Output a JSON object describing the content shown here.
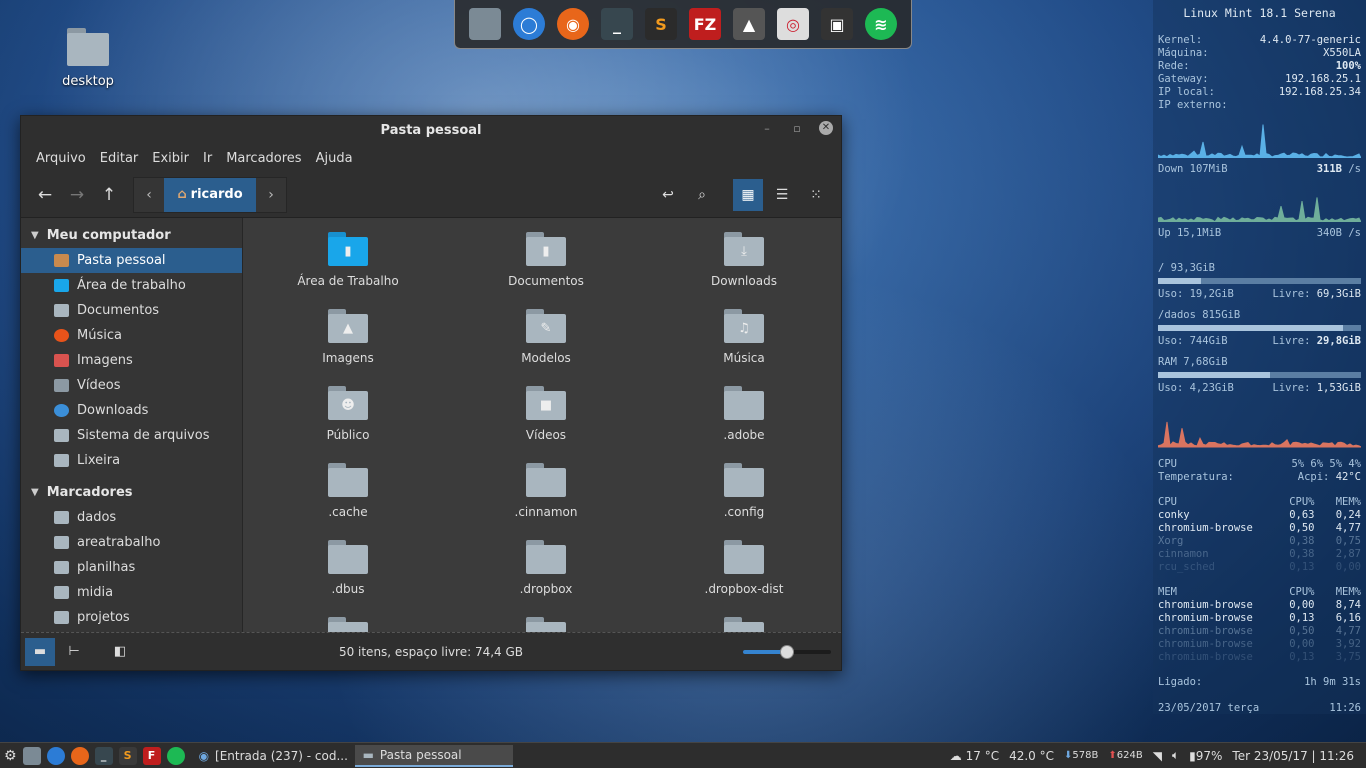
{
  "desktop": {
    "icon_label": "desktop"
  },
  "dock": {
    "apps": [
      {
        "name": "files",
        "glyph": "",
        "color": "#7b8a95"
      },
      {
        "name": "chromium",
        "glyph": "◯",
        "color": "#2c7cd6"
      },
      {
        "name": "firefox",
        "glyph": "◉",
        "color": "#e8661a"
      },
      {
        "name": "terminal",
        "glyph": "_",
        "color": "#37474f"
      },
      {
        "name": "sublime",
        "glyph": "S",
        "color": "#2b2b2b"
      },
      {
        "name": "filezilla",
        "glyph": "FZ",
        "color": "#bf1e1e"
      },
      {
        "name": "inkscape",
        "glyph": "▲",
        "color": "#555555"
      },
      {
        "name": "camera",
        "glyph": "◎",
        "color": "#dddddd"
      },
      {
        "name": "video-editor",
        "glyph": "▣",
        "color": "#333333"
      },
      {
        "name": "spotify",
        "glyph": "≋",
        "color": "#1db954"
      }
    ]
  },
  "window": {
    "title": "Pasta pessoal",
    "menu": [
      "Arquivo",
      "Editar",
      "Exibir",
      "Ir",
      "Marcadores",
      "Ajuda"
    ],
    "path": {
      "current": "ricardo"
    },
    "sidebar": {
      "section1": "Meu computador",
      "items1": [
        {
          "label": "Pasta pessoal",
          "icon": "home-icon",
          "color": "#c98a4e"
        },
        {
          "label": "Área de trabalho",
          "icon": "desktop-folder-icon",
          "color": "#19a6ea"
        },
        {
          "label": "Documentos",
          "icon": "documents-icon",
          "color": "#a9b6bf"
        },
        {
          "label": "Música",
          "icon": "music-icon",
          "color": "#e8531a"
        },
        {
          "label": "Imagens",
          "icon": "images-icon",
          "color": "#d9534f"
        },
        {
          "label": "Vídeos",
          "icon": "videos-icon",
          "color": "#8c99a3"
        },
        {
          "label": "Downloads",
          "icon": "downloads-icon",
          "color": "#3b8fd9"
        },
        {
          "label": "Sistema de arquivos",
          "icon": "filesystem-icon",
          "color": "#a9b6bf"
        },
        {
          "label": "Lixeira",
          "icon": "trash-icon",
          "color": "#a9b6bf"
        }
      ],
      "section2": "Marcadores",
      "items2": [
        {
          "label": "dados"
        },
        {
          "label": "areatrabalho"
        },
        {
          "label": "planilhas"
        },
        {
          "label": "midia"
        },
        {
          "label": "projetos"
        }
      ]
    },
    "files": [
      {
        "name": "Área de Trabalho",
        "glyph": "▮",
        "blue": true
      },
      {
        "name": "Documentos",
        "glyph": "▮"
      },
      {
        "name": "Downloads",
        "glyph": "⤓"
      },
      {
        "name": "Imagens",
        "glyph": "▲"
      },
      {
        "name": "Modelos",
        "glyph": "✎"
      },
      {
        "name": "Música",
        "glyph": "♫"
      },
      {
        "name": "Público",
        "glyph": "☻"
      },
      {
        "name": "Vídeos",
        "glyph": "■"
      },
      {
        "name": ".adobe",
        "glyph": ""
      },
      {
        "name": ".cache",
        "glyph": ""
      },
      {
        "name": ".cinnamon",
        "glyph": ""
      },
      {
        "name": ".config",
        "glyph": ""
      },
      {
        "name": ".dbus",
        "glyph": ""
      },
      {
        "name": ".dropbox",
        "glyph": ""
      },
      {
        "name": ".dropbox-dist",
        "glyph": ""
      },
      {
        "name": "",
        "glyph": ""
      },
      {
        "name": "",
        "glyph": ""
      },
      {
        "name": "",
        "glyph": ""
      }
    ],
    "status": "50 itens, espaço livre: 74,4 GB",
    "zoom_level": 0.5
  },
  "conky": {
    "title": "Linux Mint 18.1 Serena",
    "sys": [
      {
        "k": "Kernel:",
        "v": "4.4.0-77-generic"
      },
      {
        "k": "Máquina:",
        "v": "X550LA"
      },
      {
        "k": "Rede:",
        "v": "100%"
      },
      {
        "k": "Gateway:",
        "v": "192.168.25.1"
      },
      {
        "k": "IP local:",
        "v": "192.168.25.34"
      },
      {
        "k": "IP externo:",
        "v": ""
      }
    ],
    "down": {
      "label": "Down",
      "total": "107MiB",
      "rate": "311B",
      "unit": "/s"
    },
    "up": {
      "label": "Up",
      "total": "15,1MiB",
      "rate": "340B",
      "unit": "/s"
    },
    "root": {
      "title": "/ 93,3GiB",
      "used": "Uso: 19,2GiB",
      "free_label": "Livre:",
      "free": "69,3GiB",
      "fraction": 0.21
    },
    "dados": {
      "title": "/dados 815GiB",
      "used": "Uso: 744GiB",
      "free_label": "Livre:",
      "free": "29,8GiB",
      "fraction": 0.91
    },
    "ram": {
      "title": "RAM  7,68GiB",
      "used": "Uso: 4,23GiB",
      "free_label": "Livre:",
      "free": "1,53GiB",
      "fraction": 0.55
    },
    "cpu": {
      "label": "CPU",
      "values": "5%  6%  5%  4%",
      "temp_label": "Temperatura:",
      "temp_src": "Acpi:",
      "temp": "42°C"
    },
    "cpu_table": {
      "h": [
        "CPU",
        "CPU%",
        "MEM%"
      ],
      "rows": [
        [
          "conky",
          "0,63",
          "0,24"
        ],
        [
          "chromium-browse",
          "0,50",
          "4,77"
        ],
        [
          "Xorg",
          "0,38",
          "0,75"
        ],
        [
          "cinnamon",
          "0,38",
          "2,87"
        ],
        [
          "rcu_sched",
          "0,13",
          "0,00"
        ]
      ]
    },
    "mem_table": {
      "h": [
        "MEM",
        "CPU%",
        "MEM%"
      ],
      "rows": [
        [
          "chromium-browse",
          "0,00",
          "8,74"
        ],
        [
          "chromium-browse",
          "0,13",
          "6,16"
        ],
        [
          "chromium-browse",
          "0,50",
          "4,77"
        ],
        [
          "chromium-browse",
          "0,00",
          "3,92"
        ],
        [
          "chromium-browse",
          "0,13",
          "3,75"
        ]
      ]
    },
    "uptime_label": "Ligado:",
    "uptime": "1h 9m 31s",
    "date": "23/05/2017 terça",
    "time": "11:26"
  },
  "taskbar": {
    "win1": "[Entrada (237) - cod...",
    "win2": "Pasta pessoal",
    "weather": "17 °C",
    "temp": "42.0 °C",
    "down": "578B",
    "up": "624B",
    "battery": "97%",
    "datetime": "Ter 23/05/17 | 11:26"
  }
}
